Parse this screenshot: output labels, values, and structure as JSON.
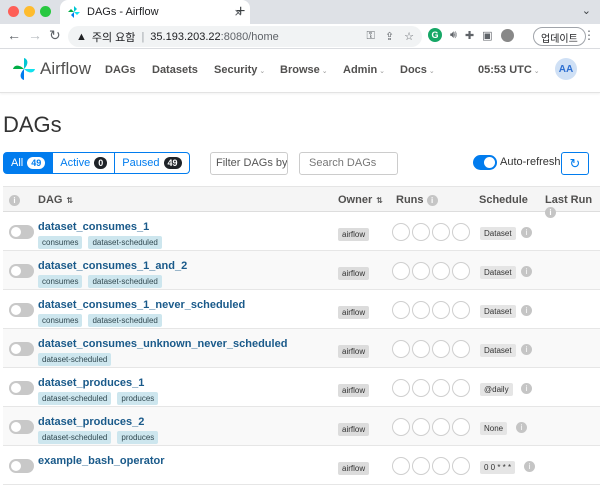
{
  "browser": {
    "tab_title": "DAGs - Airflow",
    "new_tab": "+",
    "address_warning": "주의 요함",
    "address_host": "35.193.203.22",
    "address_path": ":8080/home",
    "update_label": "업데이트"
  },
  "nav": {
    "brand": "Airflow",
    "menu": [
      "DAGs",
      "Datasets",
      "Security",
      "Browse",
      "Admin",
      "Docs"
    ],
    "time": "05:53 UTC",
    "avatar": "AA"
  },
  "page": {
    "title": "DAGs",
    "filters": [
      {
        "label": "All",
        "count": "49",
        "active": true
      },
      {
        "label": "Active",
        "count": "0",
        "active": false
      },
      {
        "label": "Paused",
        "count": "49",
        "active": false
      }
    ],
    "tags_placeholder": "Filter DAGs by tag",
    "search_placeholder": "Search DAGs",
    "auto_refresh": "Auto-refresh"
  },
  "table": {
    "headers": {
      "dag": "DAG",
      "owner": "Owner",
      "runs": "Runs",
      "schedule": "Schedule",
      "last_run": "Last Run"
    },
    "rows": [
      {
        "name": "dataset_consumes_1",
        "tags": [
          "consumes",
          "dataset-scheduled"
        ],
        "owner": "airflow",
        "schedule": "Dataset"
      },
      {
        "name": "dataset_consumes_1_and_2",
        "tags": [
          "consumes",
          "dataset-scheduled"
        ],
        "owner": "airflow",
        "schedule": "Dataset"
      },
      {
        "name": "dataset_consumes_1_never_scheduled",
        "tags": [
          "consumes",
          "dataset-scheduled"
        ],
        "owner": "airflow",
        "schedule": "Dataset"
      },
      {
        "name": "dataset_consumes_unknown_never_scheduled",
        "tags": [
          "dataset-scheduled"
        ],
        "owner": "airflow",
        "schedule": "Dataset"
      },
      {
        "name": "dataset_produces_1",
        "tags": [
          "dataset-scheduled",
          "produces"
        ],
        "owner": "airflow",
        "schedule": "@daily"
      },
      {
        "name": "dataset_produces_2",
        "tags": [
          "dataset-scheduled",
          "produces"
        ],
        "owner": "airflow",
        "schedule": "None"
      },
      {
        "name": "example_bash_operator",
        "tags": [],
        "owner": "airflow",
        "schedule": "0 0 * * *"
      }
    ]
  },
  "colors": {
    "accent": "#017cee",
    "dag_link": "#1a5a8a",
    "tag_bg": "#cde6ee"
  }
}
